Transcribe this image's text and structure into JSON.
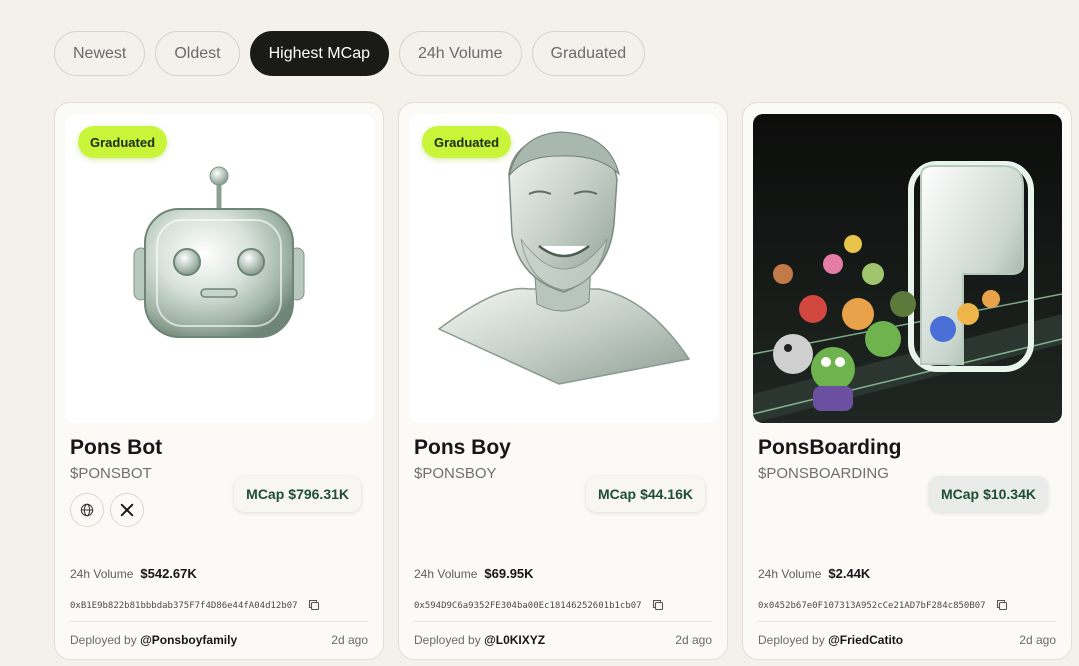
{
  "filters": {
    "newest": "Newest",
    "oldest": "Oldest",
    "highest_mcap": "Highest MCap",
    "volume_24h": "24h Volume",
    "graduated": "Graduated"
  },
  "active_filter": "Highest MCap",
  "colors": {
    "background": "#f4f1ea",
    "graduated_badge": "#c8f53a",
    "mcap_text": "#1f4d36",
    "active_pill": "#1a1a16"
  },
  "cards": [
    {
      "badge": "Graduated",
      "mcap_label": "MCap",
      "mcap_value": "$796.31K",
      "name": "Pons Bot",
      "ticker": "$PONSBOT",
      "socials": [
        "globe-icon",
        "x-icon"
      ],
      "volume_label": "24h Volume",
      "volume_value": "$542.67K",
      "address": "0xB1E9b822b81bbbdab375F7f4D86e44fA04d12b07",
      "deployed_label": "Deployed by",
      "deployer": "@Ponsboyfamily",
      "age": "2d ago",
      "image": "robot-head-image"
    },
    {
      "badge": "Graduated",
      "mcap_label": "MCap",
      "mcap_value": "$44.16K",
      "name": "Pons Boy",
      "ticker": "$PONSBOY",
      "volume_label": "24h Volume",
      "volume_value": "$69.95K",
      "address": "0x594D9C6a9352FE304ba00Ec18146252601b1cb07",
      "deployed_label": "Deployed by",
      "deployer": "@L0KIXYZ",
      "age": "2d ago",
      "image": "chrome-man-portrait-image"
    },
    {
      "mcap_label": "MCap",
      "mcap_value": "$10.34K",
      "name": "PonsBoarding",
      "ticker": "$PONSBOARDING",
      "volume_label": "24h Volume",
      "volume_value": "$2.44K",
      "address": "0x0452b67e0F107313A952cCe21AD7bF284c850B07",
      "deployed_label": "Deployed by",
      "deployer": "@FriedCatito",
      "age": "2d ago",
      "image": "characters-boarding-image"
    }
  ]
}
